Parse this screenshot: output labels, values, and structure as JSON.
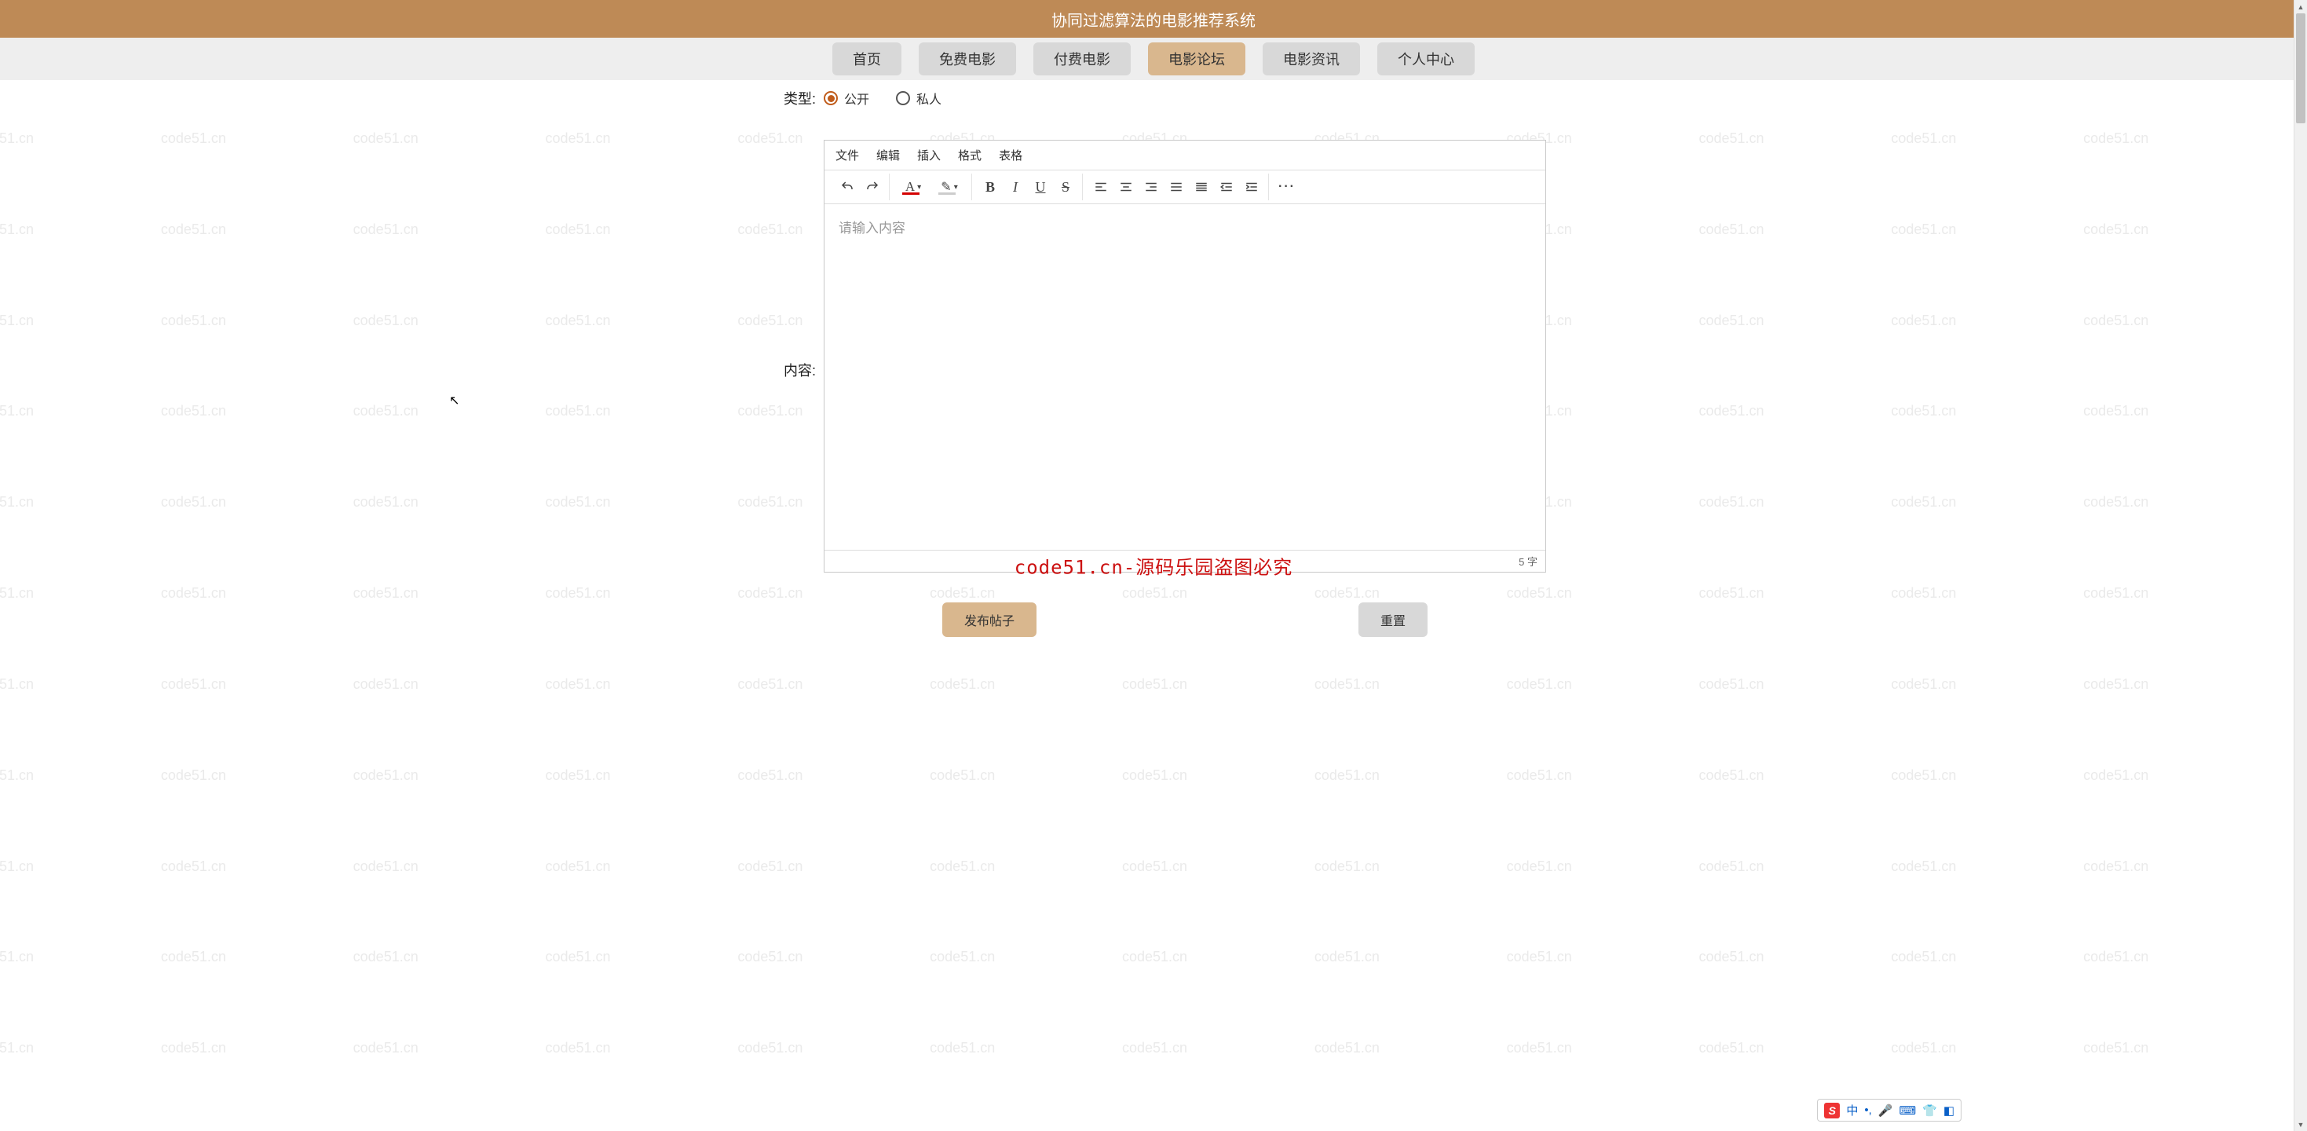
{
  "watermark_text": "code51.cn",
  "center_watermark": "code51.cn-源码乐园盗图必究",
  "banner": {
    "title": "协同过滤算法的电影推荐系统"
  },
  "nav": {
    "items": [
      {
        "label": "首页",
        "active": false
      },
      {
        "label": "免费电影",
        "active": false
      },
      {
        "label": "付费电影",
        "active": false
      },
      {
        "label": "电影论坛",
        "active": true
      },
      {
        "label": "电影资讯",
        "active": false
      },
      {
        "label": "个人中心",
        "active": false
      }
    ]
  },
  "form": {
    "type_label": "类型:",
    "type_options": [
      {
        "label": "公开",
        "checked": true
      },
      {
        "label": "私人",
        "checked": false
      }
    ],
    "content_label": "内容:"
  },
  "editor": {
    "menus": [
      "文件",
      "编辑",
      "插入",
      "格式",
      "表格"
    ],
    "tool_groups": [
      [
        "undo",
        "redo"
      ],
      [
        "textcolor",
        "hilite"
      ],
      [
        "bold",
        "italic",
        "underline",
        "strike"
      ],
      [
        "align-left",
        "align-center",
        "align-right",
        "align-justify",
        "align-dist",
        "indent-out",
        "indent-in"
      ],
      [
        "more"
      ]
    ],
    "placeholder": "请输入内容",
    "status": "5 字"
  },
  "buttons": {
    "submit": "发布帖子",
    "reset": "重置"
  },
  "ime": {
    "logo": "S",
    "items": [
      "中",
      "•,",
      "🎤",
      "⌨",
      "👕",
      "◧"
    ]
  }
}
